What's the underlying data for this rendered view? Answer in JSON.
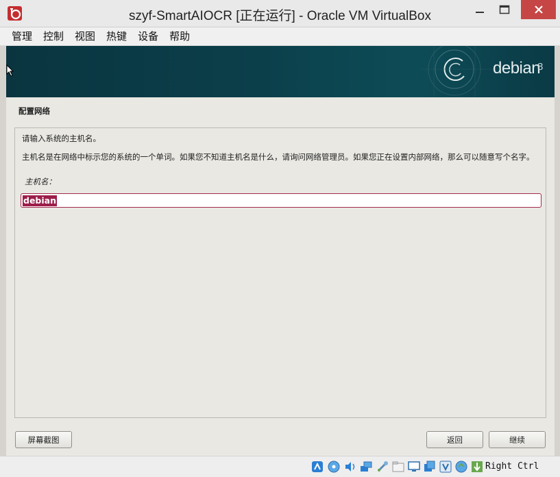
{
  "window": {
    "title": "szyf-SmartAIOCR [正在运行] - Oracle VM VirtualBox"
  },
  "menu": {
    "items": [
      "管理",
      "控制",
      "视图",
      "热键",
      "设备",
      "帮助"
    ]
  },
  "banner": {
    "brand": "debian",
    "version": "8"
  },
  "installer": {
    "page_title": "配置网络",
    "prompt": "请输入系统的主机名。",
    "description": "主机名是在网络中标示您的系统的一个单词。如果您不知道主机名是什么，请询问网络管理员。如果您正在设置内部网络，那么可以随意写个名字。",
    "field_label": "主机名：",
    "hostname_value": "debian",
    "buttons": {
      "screenshot": "屏幕截图",
      "back": "返回",
      "continue": "继续"
    }
  },
  "statusbar": {
    "host_key": "Right Ctrl",
    "icons": [
      "hard-disk-icon",
      "optical-drive-icon",
      "audio-icon",
      "network-icon",
      "usb-icon",
      "shared-folders-icon",
      "display-icon",
      "video-capture-icon",
      "virtualization-icon",
      "mouse-integration-icon",
      "keyboard-capture-icon"
    ]
  },
  "colors": {
    "banner": "#0b3f4a",
    "accent": "#9c1d4a",
    "close_button": "#c64645"
  }
}
